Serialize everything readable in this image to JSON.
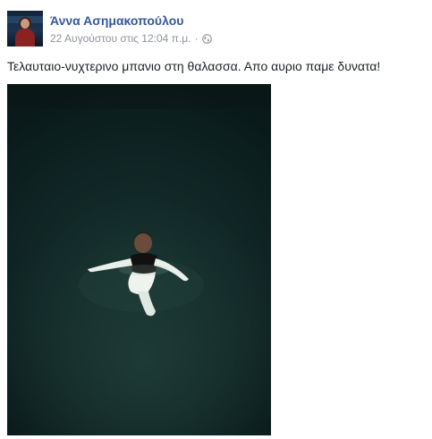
{
  "author": {
    "name": "Άννα Ασημακοπούλου"
  },
  "post": {
    "timestamp": "22 Αυγούστου στις 12:04 π.μ.",
    "separator": "·",
    "privacy_icon": "globe-icon",
    "text": "Τελαυταιο-νυχτερινο μπανιο στη θαλασσα. Απο αυριο παμε δυνατα!"
  },
  "colors": {
    "name_link": "#365899",
    "meta_text": "#90949c",
    "body_text": "#1d2129"
  }
}
